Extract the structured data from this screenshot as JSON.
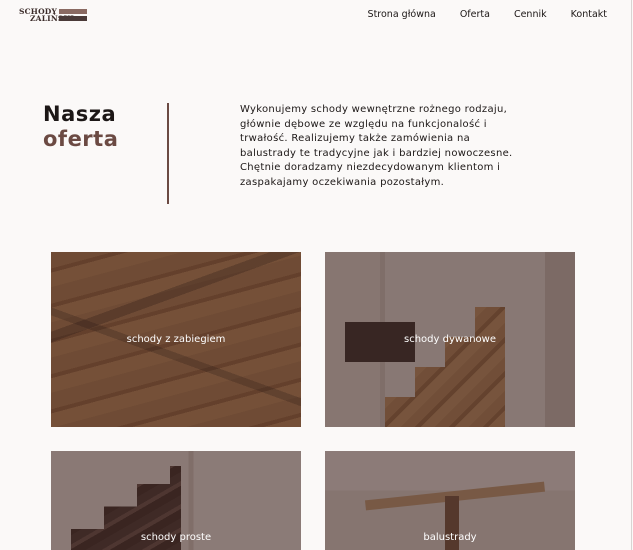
{
  "logo": {
    "line1": "SCHODY",
    "line2": "ZALIŃSKI"
  },
  "nav": {
    "items": [
      {
        "label": "Strona główna"
      },
      {
        "label": "Oferta"
      },
      {
        "label": "Cennik"
      },
      {
        "label": "Kontakt"
      }
    ]
  },
  "offer": {
    "heading_line1": "Nasza",
    "heading_line2": "oferta",
    "intro": "Wykonujemy schody wewnętrzne rożnego rodzaju, głównie dębowe ze względu na funkcjonalość i trwałość. Realizujemy także zamówienia na balustrady te tradycyjne jak i bardziej nowoczesne. Chętnie doradzamy niezdecydowanym klientom i zaspakajamy oczekiwania pozostałym."
  },
  "cards": [
    {
      "label": "schody z zabiegiem"
    },
    {
      "label": "schody dywanowe"
    },
    {
      "label": "schody proste"
    },
    {
      "label": "balustrady"
    }
  ],
  "colors": {
    "background": "#fbf9f8",
    "accent": "#6b4a43",
    "text": "#1c1716",
    "card_overlay": "rgba(55, 30, 25, 0.55)"
  }
}
